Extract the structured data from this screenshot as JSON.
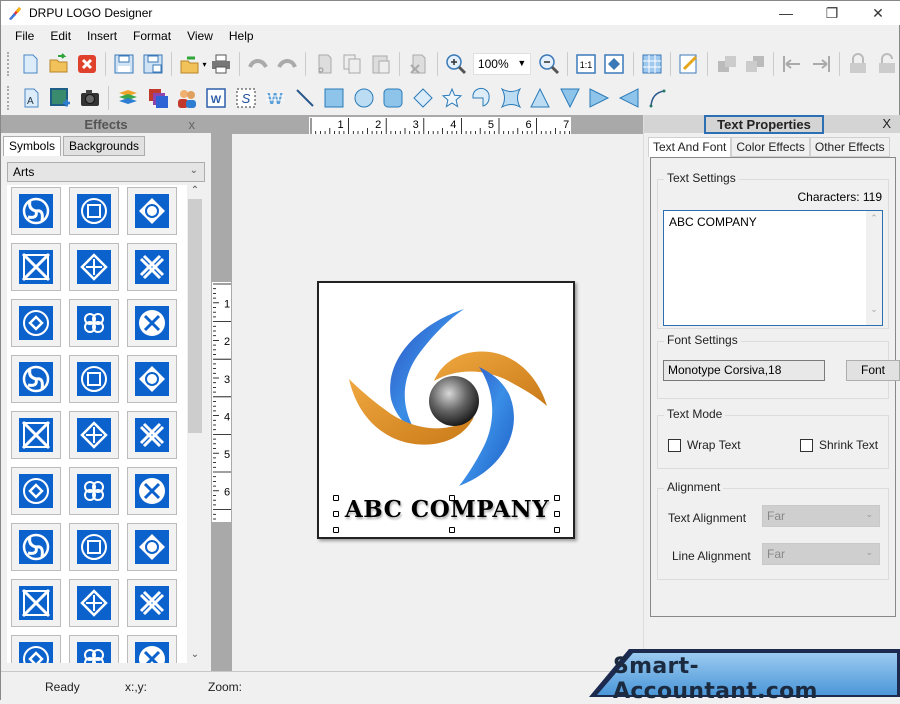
{
  "window": {
    "title": "DRPU LOGO Designer",
    "controls": {
      "minimize": "—",
      "maximize": "❐",
      "close": "✕"
    }
  },
  "menu": [
    "File",
    "Edit",
    "Insert",
    "Format",
    "View",
    "Help"
  ],
  "toolbar1": {
    "items": [
      "new-icon",
      "open-icon",
      "close-file-icon",
      "save-icon",
      "save-as-icon",
      "import-icon",
      "print-icon",
      "undo-icon",
      "redo-icon",
      "cut-icon",
      "copy-icon",
      "paste-icon",
      "delete-icon",
      "zoom-in-icon",
      "zoom-out-icon",
      "actual-size-icon",
      "fit-to-window-icon",
      "grid-icon",
      "edit-icon",
      "bring-forward-icon",
      "send-backward-icon",
      "align-left-icon",
      "align-right-icon",
      "lock-icon",
      "unlock-icon"
    ],
    "zoom_value": "100%"
  },
  "toolbar2": {
    "items": [
      "text-icon",
      "image-icon",
      "camera-icon",
      "layers-icon",
      "background-icon",
      "users-icon",
      "wordart-icon",
      "signature-icon",
      "watermark-icon",
      "line-icon",
      "rectangle-icon",
      "ellipse-icon",
      "rounded-rectangle-icon",
      "diamond-icon",
      "star-icon",
      "arc-icon",
      "star4-icon",
      "triangle-up-icon",
      "triangle-down-icon",
      "triangle-right-icon",
      "triangle-left-icon",
      "curve-icon"
    ]
  },
  "effects_panel": {
    "title": "Effects",
    "close": "x",
    "tabs": [
      "Symbols",
      "Backgrounds"
    ],
    "active_tab": "Symbols",
    "category": "Arts",
    "symbol_count": 27
  },
  "canvas": {
    "ruler_h": [
      "1",
      "2",
      "3",
      "4",
      "5",
      "6",
      "7"
    ],
    "ruler_v": [
      "1",
      "2",
      "3",
      "4",
      "5",
      "6"
    ],
    "logo_text": "ABC COMPANY",
    "colors": {
      "blue": "#1f6fd0",
      "orange": "#e08a22",
      "sphere": "#333333"
    }
  },
  "text_properties": {
    "title": "Text Properties",
    "close": "X",
    "tabs": [
      "Text And Font",
      "Color Effects",
      "Other Effects"
    ],
    "active_tab": "Text And Font",
    "text_settings": {
      "legend": "Text Settings",
      "characters_label": "Characters: 119",
      "text": "ABC COMPANY"
    },
    "font_settings": {
      "legend": "Font Settings",
      "font_value": "Monotype Corsiva,18",
      "font_button": "Font"
    },
    "text_mode": {
      "legend": "Text Mode",
      "wrap_text": {
        "label": "Wrap Text",
        "checked": false
      },
      "shrink_text": {
        "label": "Shrink Text",
        "checked": false
      }
    },
    "alignment": {
      "legend": "Alignment",
      "text_alignment_label": "Text Alignment",
      "text_alignment_value": "Far",
      "line_alignment_label": "Line Alignment",
      "line_alignment_value": "Far"
    }
  },
  "status": {
    "state": "Ready",
    "coords": "x:,y:",
    "zoom": "Zoom:"
  },
  "watermark": "Smart-Accountant.com"
}
